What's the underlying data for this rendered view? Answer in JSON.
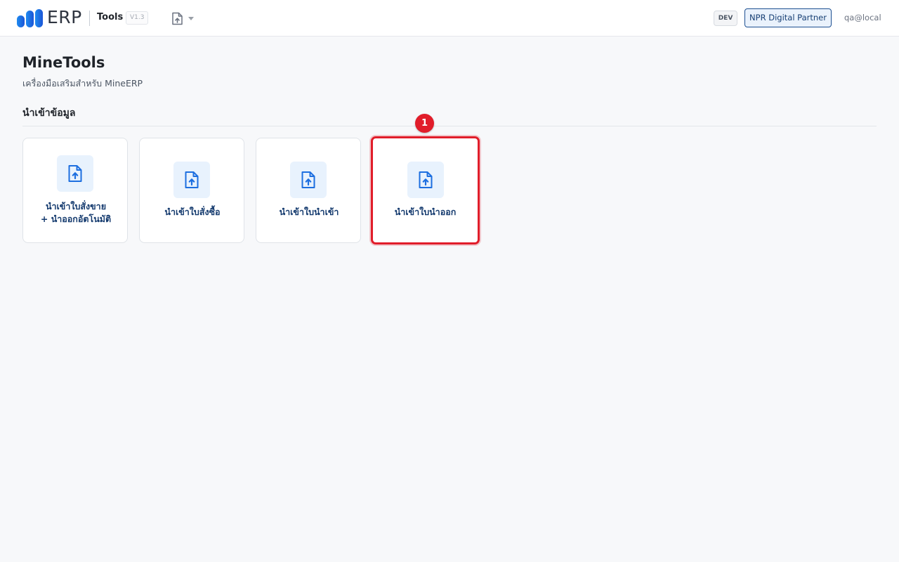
{
  "header": {
    "logo_text": "ERP",
    "app_title": "Tools",
    "version": "V1.3",
    "env": "DEV",
    "partner_label": "NPR Digital Partner",
    "user": "qa@local"
  },
  "page": {
    "title": "MineTools",
    "subtitle": "เครื่องมือเสริมสำหรับ MineERP"
  },
  "section": {
    "title": "นำเข้าข้อมูล"
  },
  "tiles": [
    {
      "line1": "นำเข้าใบสั่งขาย",
      "line2": "+ นำออกอัตโนมัติ",
      "icon": "file-upload-icon"
    },
    {
      "line1": "นำเข้าใบสั่งซื้อ",
      "icon": "file-upload-icon"
    },
    {
      "line1": "นำเข้าใบนำเข้า",
      "icon": "file-upload-icon"
    },
    {
      "line1": "นำเข้าใบนำออก",
      "icon": "file-upload-icon",
      "highlighted": true
    }
  ],
  "annotation": {
    "step": "1"
  },
  "colors": {
    "brand_blue": "#1d6fe0",
    "highlight_red": "#e11d2a",
    "tile_label": "#143a6e",
    "icon_bg": "#e8f2fd"
  }
}
